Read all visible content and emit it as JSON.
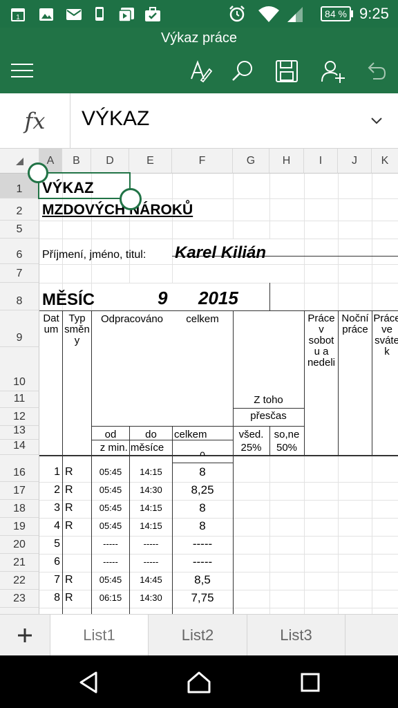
{
  "status": {
    "battery": "84 %",
    "time": "9:25"
  },
  "app": {
    "title": "Výkaz práce"
  },
  "formula_bar": {
    "fx": "fx",
    "value": "VÝKAZ"
  },
  "columns": [
    "A",
    "B",
    "D",
    "E",
    "F",
    "G",
    "H",
    "I",
    "J",
    "K"
  ],
  "rows": [
    "1",
    "2",
    "5",
    "6",
    "7",
    "8",
    "9",
    "10",
    "11",
    "12",
    "13",
    "14",
    "16",
    "17",
    "18",
    "19",
    "20",
    "21",
    "22",
    "23"
  ],
  "cells": {
    "title1": "VÝKAZ",
    "title2": "MZDOVÝCH  NÁROKŮ",
    "name_label": "Příjmení, jméno, titul:",
    "name_value": "Karel Kilián",
    "month_label": "MĚSÍC",
    "month_value": "9",
    "year_value": "2015",
    "h_datum": "Dat\num",
    "h_typ": "Typ\nsměn\ny",
    "h_odpracovano": "Odpracováno",
    "h_celkem_top": "celkem",
    "h_prace_sobot": "Práce\nv\nsobot\nu a\nnedeli",
    "h_nocni": "Noční\npráce",
    "h_prace_svatek": "Práce\nve\nsváte\nk",
    "h_ztoho": "Z toho",
    "h_prescas": "přesčas",
    "h_od": "od",
    "h_do": "do",
    "h_celkem": "celkem",
    "h_zmin": "z min.  měsíce",
    "h_vsed": "všed.",
    "h_sone": "so,ne",
    "h_25": "25%",
    "h_50": "50%",
    "partial": "0"
  },
  "data_rows": [
    {
      "row": "16",
      "day": "1",
      "type": "R",
      "from": "05:45",
      "to": "14:15",
      "total": "8"
    },
    {
      "row": "17",
      "day": "2",
      "type": "R",
      "from": "05:45",
      "to": "14:30",
      "total": "8,25"
    },
    {
      "row": "18",
      "day": "3",
      "type": "R",
      "from": "05:45",
      "to": "14:15",
      "total": "8"
    },
    {
      "row": "19",
      "day": "4",
      "type": "R",
      "from": "05:45",
      "to": "14:15",
      "total": "8"
    },
    {
      "row": "20",
      "day": "5",
      "type": "",
      "from": "-----",
      "to": "-----",
      "total": "-----"
    },
    {
      "row": "21",
      "day": "6",
      "type": "",
      "from": "-----",
      "to": "-----",
      "total": "-----"
    },
    {
      "row": "22",
      "day": "7",
      "type": "R",
      "from": "05:45",
      "to": "14:45",
      "total": "8,5"
    },
    {
      "row": "23",
      "day": "8",
      "type": "R",
      "from": "06:15",
      "to": "14:30",
      "total": "7,75"
    }
  ],
  "sheet_tabs": [
    "List1",
    "List2",
    "List3"
  ],
  "colors": {
    "accent": "#217346",
    "statusbar": "#1e7145"
  }
}
